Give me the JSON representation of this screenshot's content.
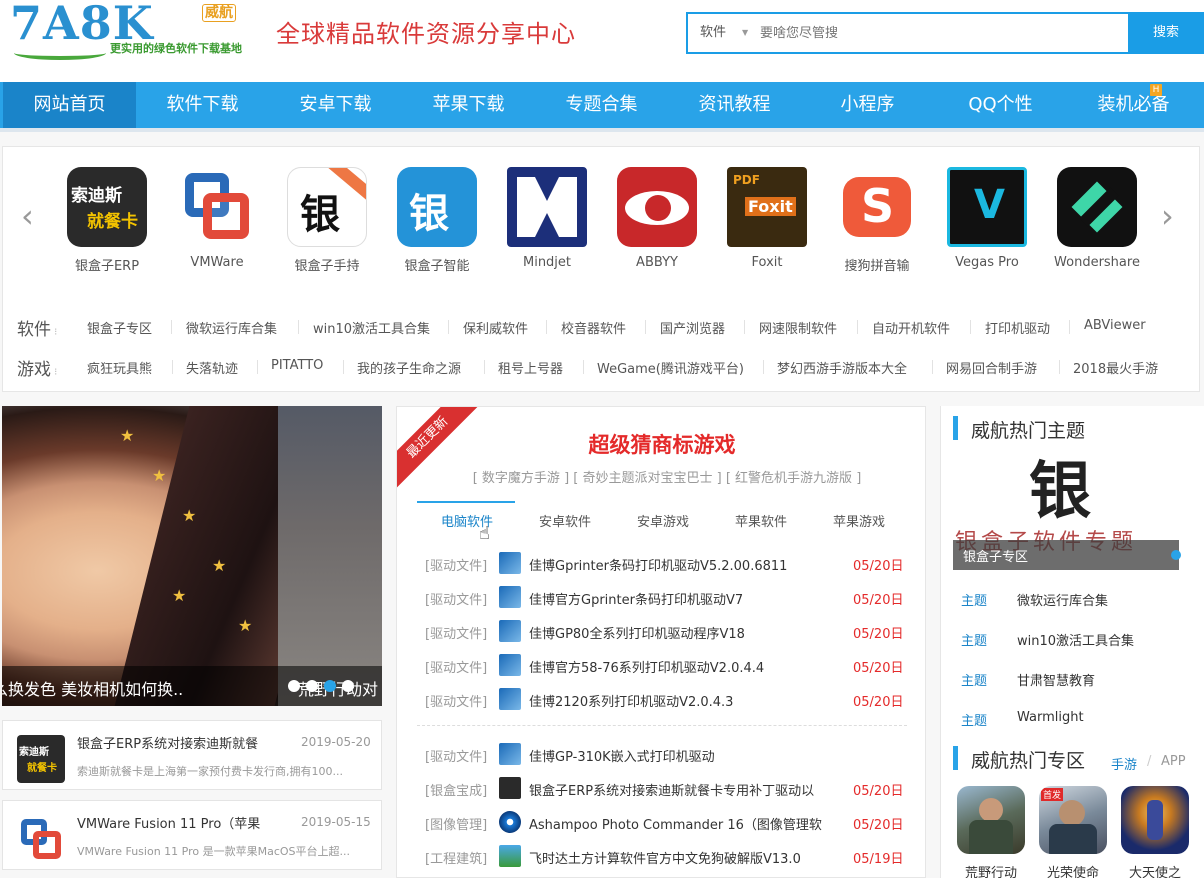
{
  "header": {
    "logo_text": "7A8K",
    "logo_badge": "威航",
    "logo_sub": "更实用的绿色软件下载基地",
    "slogan": "全球精品软件资源分享中心",
    "search": {
      "category": "软件",
      "placeholder": "要啥您尽管搜",
      "button": "搜索"
    }
  },
  "nav": {
    "items": [
      "网站首页",
      "软件下载",
      "安卓下载",
      "苹果下载",
      "专题合集",
      "资讯教程",
      "小程序",
      "QQ个性",
      "装机必备"
    ],
    "active_index": 0,
    "badge": "H"
  },
  "featured_apps": {
    "prev": "‹",
    "next": "›",
    "items": [
      {
        "name": "银盒子ERP",
        "icon": "suodisi-icon"
      },
      {
        "name": "VMWare",
        "icon": "vmware-icon"
      },
      {
        "name": "银盒子手持",
        "icon": "yinhezi-pos-icon"
      },
      {
        "name": "银盒子智能",
        "icon": "yinhezi-smart-icon"
      },
      {
        "name": "Mindjet",
        "icon": "mindjet-icon"
      },
      {
        "name": "ABBYY",
        "icon": "abbyy-icon"
      },
      {
        "name": "Foxit",
        "icon": "foxit-icon"
      },
      {
        "name": "搜狗拼音输",
        "icon": "sogou-icon"
      },
      {
        "name": "Vegas Pro",
        "icon": "vegas-icon"
      },
      {
        "name": "Wondershare",
        "icon": "filmora-icon"
      }
    ]
  },
  "tags": {
    "software_label": "软件",
    "software": [
      "银盒子专区",
      "微软运行库合集",
      "win10激活工具合集",
      "保利威软件",
      "校音器软件",
      "国产浏览器",
      "网速限制软件",
      "自动开机软件",
      "打印机驱动",
      "ABViewer"
    ],
    "games_label": "游戏",
    "games": [
      "疯狂玩具熊",
      "失落轨迹",
      "PITATTO",
      "我的孩子生命之源",
      "租号上号器",
      "WeGame(腾讯游戏平台)",
      "梦幻西游手游版本大全",
      "网易回合制手游",
      "2018最火手游"
    ]
  },
  "slider": {
    "caption": "么换发色 美妆相机如何换..",
    "caption2": "荒野行动对",
    "dots": 4,
    "active_dot": 2
  },
  "news_cards": [
    {
      "title": "银盒子ERP系统对接索迪斯就餐",
      "date": "2019-05-20",
      "excerpt": "索迪斯就餐卡是上海第一家预付费卡发行商,拥有100..."
    },
    {
      "title": "VMWare Fusion 11 Pro（苹果",
      "date": "2019-05-15",
      "excerpt": "VMWare Fusion 11 Pro 是一款苹果MacOS平台上超..."
    }
  ],
  "feature": {
    "ribbon": "最近更新",
    "title": "超级猜商标游戏",
    "links": [
      "数字魔方手游",
      "奇妙主题派对宝宝巴士",
      "红警危机手游九游版"
    ],
    "tabs": [
      "电脑软件",
      "安卓软件",
      "安卓游戏",
      "苹果软件",
      "苹果游戏"
    ],
    "active_tab": 0,
    "rows": [
      {
        "cat": "[驱动文件]",
        "title": "佳博Gprinter条码打印机驱动V5.2.00.6811",
        "date": "05/20日"
      },
      {
        "cat": "[驱动文件]",
        "title": "佳博官方Gprinter条码打印机驱动V7",
        "date": "05/20日"
      },
      {
        "cat": "[驱动文件]",
        "title": "佳博GP80全系列打印机驱动程序V18",
        "date": "05/20日"
      },
      {
        "cat": "[驱动文件]",
        "title": "佳博官方58-76系列打印机驱动V2.0.4.4",
        "date": "05/20日"
      },
      {
        "cat": "[驱动文件]",
        "title": "佳博2120系列打印机驱动V2.0.4.3",
        "date": "05/20日"
      },
      {
        "cat": "[驱动文件]",
        "title": "佳博GP-310K嵌入式打印机驱动",
        "date": ""
      },
      {
        "cat": "[银盒宝成]",
        "title": "银盒子ERP系统对接索迪斯就餐卡专用补丁驱动以",
        "date": "05/20日"
      },
      {
        "cat": "[图像管理]",
        "title": "Ashampoo Photo Commander 16（图像管理软",
        "date": "05/20日"
      },
      {
        "cat": "[工程建筑]",
        "title": "飞时达土方计算软件官方中文免狗破解版V13.0",
        "date": "05/19日"
      }
    ]
  },
  "sidebar": {
    "hot_topics_title": "威航热门主题",
    "theme_overlay": "银盒子软件专题",
    "theme_label": "银盒子专区",
    "topics": [
      {
        "k": "主题",
        "v": "微软运行库合集"
      },
      {
        "k": "主题",
        "v": "win10激活工具合集"
      },
      {
        "k": "主题",
        "v": "甘肃智慧教育"
      },
      {
        "k": "主题",
        "v": "Warmlight"
      }
    ],
    "hot_zone_title": "威航热门专区",
    "zone_tabs": [
      "手游",
      "APP"
    ],
    "zone_sep": "/",
    "games": [
      "荒野行动",
      "光荣使命",
      "大天使之"
    ]
  },
  "colors": {
    "primary": "#29a3e8",
    "nav_active": "#1a84c9",
    "red": "#e42a2a"
  }
}
